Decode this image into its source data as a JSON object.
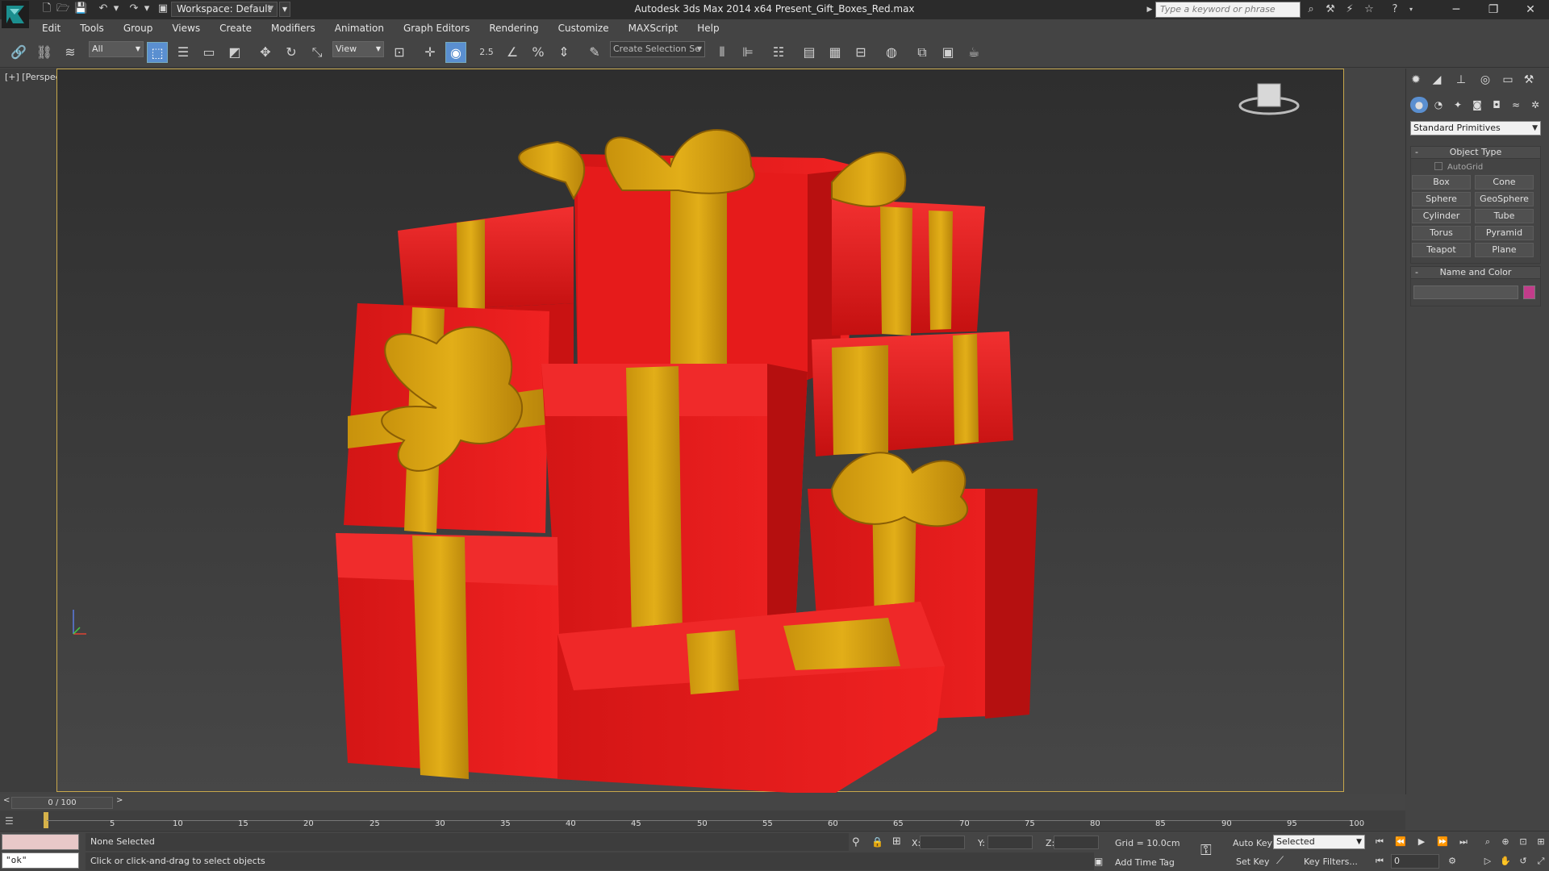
{
  "titlebar": {
    "workspace_label": "Workspace: Default",
    "app_title": "Autodesk 3ds Max  2014 x64     Present_Gift_Boxes_Red.max",
    "search_placeholder": "Type a keyword or phrase"
  },
  "menubar": {
    "items": [
      "Edit",
      "Tools",
      "Group",
      "Views",
      "Create",
      "Modifiers",
      "Animation",
      "Graph Editors",
      "Rendering",
      "Customize",
      "MAXScript",
      "Help"
    ]
  },
  "toolbar": {
    "filter_select": "All",
    "refcoord_select": "View",
    "snap_value": "2.5",
    "named_selection_placeholder": "Create Selection Se"
  },
  "viewport": {
    "label": "[+] [Perspective] [Shaded]"
  },
  "command_panel": {
    "category_dropdown": "Standard Primitives",
    "object_type_title": "Object Type",
    "autogrid_label": "AutoGrid",
    "primitives": [
      "Box",
      "Cone",
      "Sphere",
      "GeoSphere",
      "Cylinder",
      "Tube",
      "Torus",
      "Pyramid",
      "Teapot",
      "Plane"
    ],
    "name_color_title": "Name and Color",
    "swatch_color": "#c23c8a"
  },
  "timeline": {
    "slider_label": "0 / 100",
    "ticks": [
      "5",
      "10",
      "15",
      "20",
      "25",
      "30",
      "35",
      "40",
      "45",
      "50",
      "55",
      "60",
      "65",
      "70",
      "75",
      "80",
      "85",
      "90",
      "95",
      "100"
    ]
  },
  "status": {
    "listener_text": "\"ok\"",
    "selection_text": "None Selected",
    "prompt_text": "Click or click-and-drag to select objects",
    "x_label": "X:",
    "y_label": "Y:",
    "z_label": "Z:",
    "grid_text": "Grid = 10.0cm",
    "add_time_tag": "Add Time Tag",
    "auto_key": "Auto Key",
    "set_key": "Set Key",
    "key_mode_select": "Selected",
    "key_filters": "Key Filters...",
    "current_frame": "0"
  },
  "colors": {
    "box_red": "#e01c1c",
    "ribbon_gold": "#d9a411",
    "viewport_border": "#c8a84b"
  }
}
